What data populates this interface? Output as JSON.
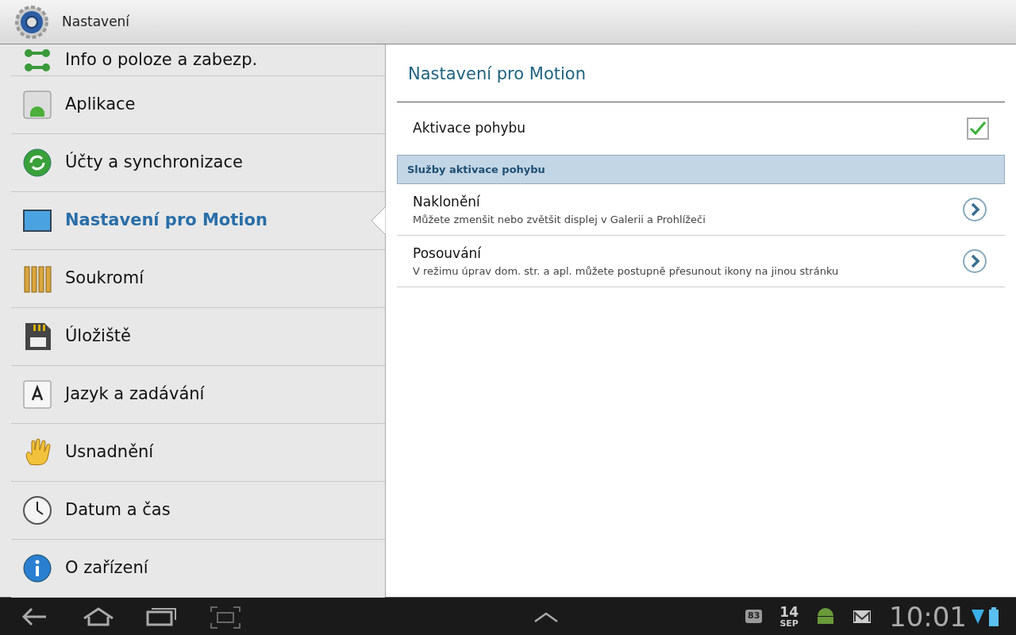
{
  "action_bar": {
    "title": "Nastavení"
  },
  "sidebar": {
    "items": [
      {
        "label": "Info o poloze a zabezp.",
        "selected": false
      },
      {
        "label": "Aplikace",
        "selected": false
      },
      {
        "label": "Účty a synchronizace",
        "selected": false
      },
      {
        "label": "Nastavení pro Motion",
        "selected": true
      },
      {
        "label": "Soukromí",
        "selected": false
      },
      {
        "label": "Úložiště",
        "selected": false
      },
      {
        "label": "Jazyk a zadávání",
        "selected": false
      },
      {
        "label": "Usnadnění",
        "selected": false
      },
      {
        "label": "Datum a čas",
        "selected": false
      },
      {
        "label": "O zařízení",
        "selected": false
      }
    ]
  },
  "detail": {
    "title": "Nastavení pro Motion",
    "toggle": {
      "label": "Aktivace pohybu",
      "checked": true
    },
    "section_header": "Služby aktivace pohybu",
    "items": [
      {
        "title": "Naklonění",
        "summary": "Můžete zmenšit nebo zvětšit displej v Galerii a Prohlížeči"
      },
      {
        "title": "Posouvání",
        "summary": "V režimu úprav dom. str. a apl. můžete postupně přesunout ikony na jinou stránku"
      }
    ]
  },
  "system_bar": {
    "notification_count": "83",
    "date_day": "14",
    "date_month": "SEP",
    "time": "10:01"
  }
}
